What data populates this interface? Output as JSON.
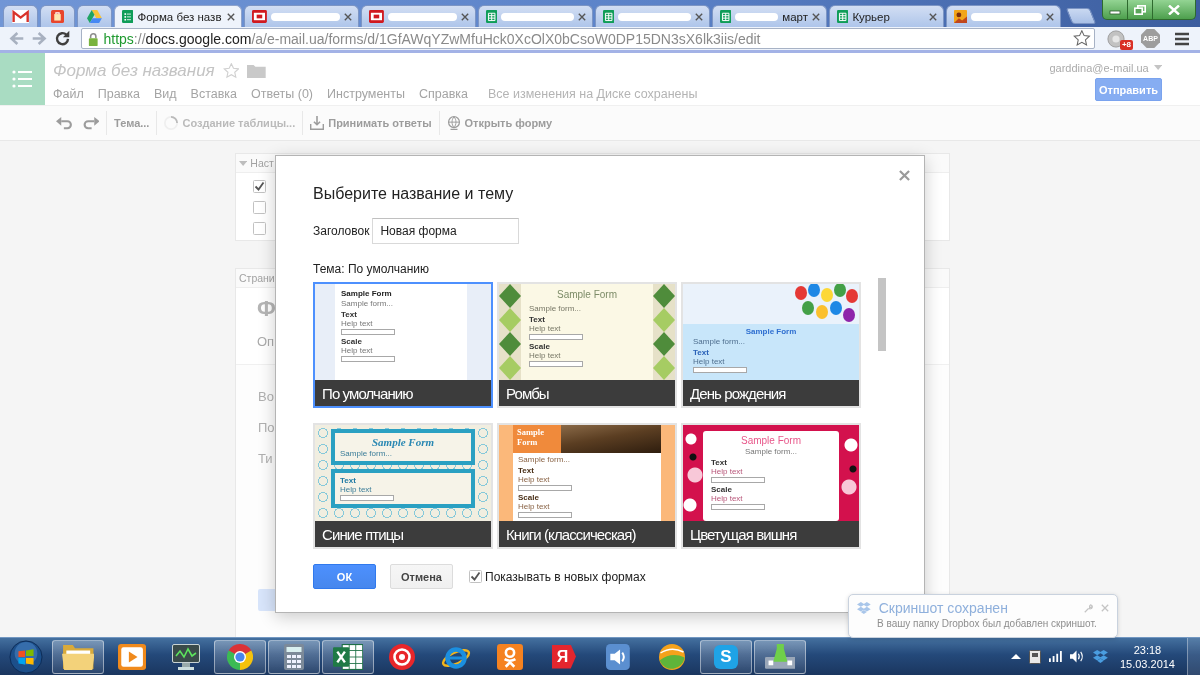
{
  "browser": {
    "tabs": [
      {
        "kind": "mail",
        "pinned": true,
        "selected": false,
        "redacted": false
      },
      {
        "kind": "bag",
        "pinned": true,
        "selected": false,
        "redacted": false
      },
      {
        "kind": "drive",
        "pinned": true,
        "selected": false,
        "redacted": false
      },
      {
        "kind": "form",
        "title": "Форма без назв",
        "pinned": false,
        "selected": true,
        "redacted": false
      },
      {
        "kind": "red",
        "pinned": false,
        "selected": false,
        "redacted": true
      },
      {
        "kind": "red",
        "pinned": false,
        "selected": false,
        "redacted": true
      },
      {
        "kind": "sheet",
        "pinned": false,
        "selected": false,
        "redacted": true
      },
      {
        "kind": "sheet",
        "pinned": false,
        "selected": false,
        "redacted": true
      },
      {
        "kind": "sheet",
        "title": "март",
        "pinned": false,
        "selected": false,
        "redacted": true
      },
      {
        "kind": "sheet",
        "title": "Курьер",
        "pinned": false,
        "selected": false,
        "redacted": false
      },
      {
        "kind": "picture",
        "pinned": false,
        "selected": false,
        "redacted": true
      }
    ],
    "url": {
      "scheme": "https",
      "separator": "://",
      "host": "docs.google.com",
      "path": "/a/e-mail.ua/forms/d/1GfAWqYZwMfuHck0XcOlX0bCsoW0DP15DN3sX6lk3iis/edit"
    },
    "extension_badge": "+8",
    "adblock_label": "ABP"
  },
  "app": {
    "title": "Форма без названия",
    "starred": false,
    "menu": [
      "Файл",
      "Правка",
      "Вид",
      "Вставка",
      "Ответы (0)",
      "Инструменты",
      "Справка"
    ],
    "save_status": "Все изменения на Диске сохранены",
    "account": "garddina@e-mail.ua",
    "send_button": "Отправить",
    "toolbar": [
      {
        "kind": "undo",
        "disabled": false
      },
      {
        "kind": "redo",
        "disabled": false
      },
      {
        "kind": "text",
        "label": "Тема...",
        "disabled": false
      },
      {
        "kind": "spinner",
        "label": "Создание таблицы...",
        "disabled": true
      },
      {
        "kind": "download",
        "label": "Принимать ответы",
        "disabled": false
      },
      {
        "kind": "globe",
        "label": "Открыть форму",
        "disabled": false
      }
    ]
  },
  "form": {
    "settings": {
      "header": "Наст",
      "expanded": true,
      "options": [
        {
          "checked": true
        },
        {
          "checked": false
        },
        {
          "checked": false
        }
      ]
    },
    "page": {
      "header": "Страни",
      "title": "Ф",
      "description": "Оп",
      "questions": [
        "Во",
        "По",
        "Ти"
      ]
    }
  },
  "dialog": {
    "title": "Выберите название и тему",
    "name_label": "Заголовок",
    "name_value": "Новая форма",
    "theme_label": "Тема: По умолчанию",
    "themes": [
      {
        "name": "По умолчанию",
        "kind": "default",
        "selected": true,
        "preview": {
          "heading": "Sample Form",
          "intro": "Sample form...",
          "fields": [
            {
              "label": "Text",
              "hint": "Help text"
            },
            {
              "label": "Scale",
              "hint": "Help text"
            }
          ]
        }
      },
      {
        "name": "Ромбы",
        "kind": "diamonds",
        "selected": false,
        "preview": {
          "heading": "Sample Form",
          "intro": "Sample form...",
          "fields": [
            {
              "label": "Text",
              "hint": "Help text"
            },
            {
              "label": "Scale",
              "hint": "Help text"
            }
          ]
        }
      },
      {
        "name": "День рождения",
        "kind": "birthday",
        "selected": false,
        "preview": {
          "heading": "Sample Form",
          "intro": "Sample form...",
          "fields": [
            {
              "label": "Text",
              "hint": "Help text"
            }
          ]
        }
      },
      {
        "name": "Синие птицы",
        "kind": "birds",
        "selected": false,
        "preview": {
          "heading": "Sample Form",
          "intro": "Sample form...",
          "fields": [
            {
              "label": "Text",
              "hint": "Help text"
            }
          ]
        }
      },
      {
        "name": "Книги (классическая)",
        "kind": "books",
        "selected": false,
        "preview": {
          "heading": "Sample Form",
          "intro": "Sample form...",
          "fields": [
            {
              "label": "Text",
              "hint": "Help text"
            },
            {
              "label": "Scale",
              "hint": "Help text"
            }
          ]
        }
      },
      {
        "name": "Цветущая вишня",
        "kind": "cherry",
        "selected": false,
        "preview": {
          "heading": "Sample Form",
          "intro": "Sample form...",
          "fields": [
            {
              "label": "Text",
              "hint": "Help text"
            },
            {
              "label": "Scale",
              "hint": "Help text"
            }
          ]
        }
      }
    ],
    "ok_button": "ОК",
    "cancel_button": "Отмена",
    "show_in_new": {
      "label": "Показывать в новых формах",
      "checked": true
    }
  },
  "notification": {
    "title": "Скриншот сохранен",
    "message": "В вашу папку Dropbox был добавлен скриншот."
  },
  "taskbar": {
    "apps": [
      {
        "kind": "folder",
        "running": true
      },
      {
        "kind": "media",
        "running": false
      },
      {
        "kind": "monitor",
        "running": false
      },
      {
        "kind": "chrome",
        "running": true
      },
      {
        "kind": "calculator",
        "running": true
      },
      {
        "kind": "excel",
        "running": true
      },
      {
        "kind": "yabrowser",
        "running": false
      },
      {
        "kind": "ie",
        "running": false
      },
      {
        "kind": "ok",
        "running": false
      },
      {
        "kind": "yandex",
        "glyph": "Я",
        "running": false
      },
      {
        "kind": "speaker",
        "running": false
      },
      {
        "kind": "ball",
        "running": false
      },
      {
        "kind": "skype",
        "glyph": "S",
        "running": true
      },
      {
        "kind": "network",
        "running": true
      }
    ],
    "time": "23:18",
    "date": "15.03.2014"
  }
}
